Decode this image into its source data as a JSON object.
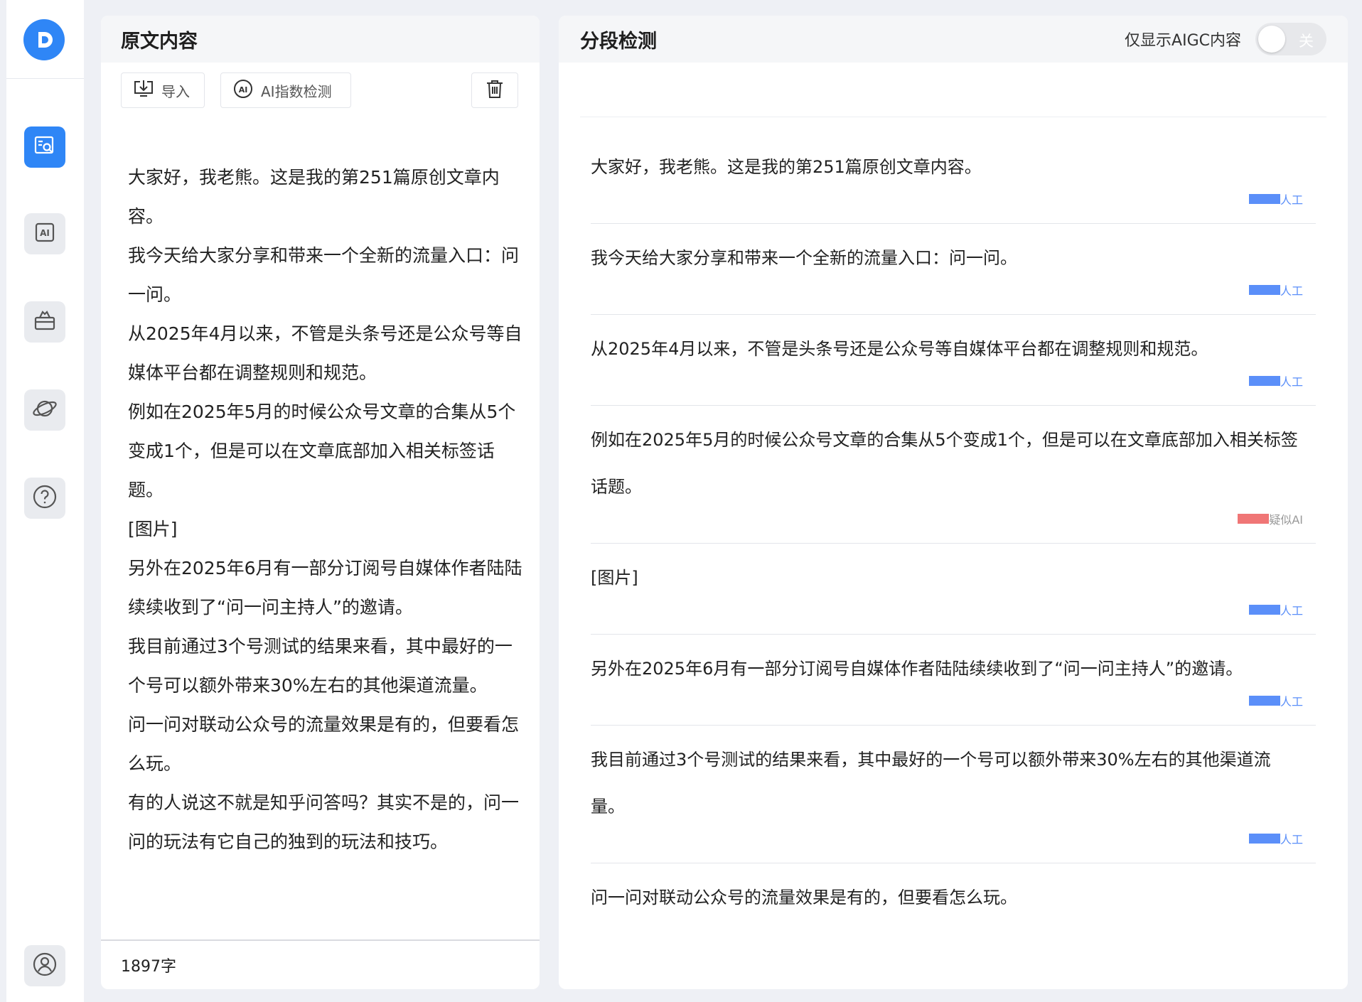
{
  "sidebar": {
    "logo": "logo-icon",
    "items": [
      {
        "icon": "document-search-icon",
        "active": true
      },
      {
        "icon": "ai-icon",
        "active": false
      },
      {
        "icon": "toolbox-icon",
        "active": false
      },
      {
        "icon": "planet-icon",
        "active": false
      },
      {
        "icon": "help-icon",
        "active": false
      }
    ],
    "bottom": {
      "icon": "user-icon"
    }
  },
  "left": {
    "title": "原文内容",
    "import_label": "导入",
    "ai_detect_label": "AI指数检测",
    "paragraphs": [
      "大家好，我老熊。这是我的第251篇原创文章内容。",
      "我今天给大家分享和带来一个全新的流量入口：问一问。",
      "从2025年4月以来，不管是头条号还是公众号等自媒体平台都在调整规则和规范。",
      "例如在2025年5月的时候公众号文章的合集从5个变成1个，但是可以在文章底部加入相关标签话题。",
      "[图片]",
      "另外在2025年6月有一部分订阅号自媒体作者陆陆续续收到了“问一问主持人”的邀请。",
      "我目前通过3个号测试的结果来看，其中最好的一个号可以额外带来30%左右的其他渠道流量。",
      "问一问对联动公众号的流量效果是有的，但要看怎么玩。",
      "有的人说这不就是知乎问答吗？其实不是的，问一问的玩法有它自己的独到的玩法和技巧。"
    ],
    "word_count": "1897字"
  },
  "right": {
    "title": "分段检测",
    "toggle_label": "仅显示AIGC内容",
    "toggle_state": "关",
    "segments": [
      {
        "text": "大家好，我老熊。这是我的第251篇原创文章内容。",
        "tag": "人工",
        "type": "human"
      },
      {
        "text": "我今天给大家分享和带来一个全新的流量入口：问一问。",
        "tag": "人工",
        "type": "human"
      },
      {
        "text": "从2025年4月以来，不管是头条号还是公众号等自媒体平台都在调整规则和规范。",
        "tag": "人工",
        "type": "human"
      },
      {
        "text": "例如在2025年5月的时候公众号文章的合集从5个变成1个，但是可以在文章底部加入相关标签话题。",
        "tag": "疑似AI",
        "type": "ai"
      },
      {
        "text": "[图片]",
        "tag": "人工",
        "type": "human"
      },
      {
        "text": "另外在2025年6月有一部分订阅号自媒体作者陆陆续续收到了“问一问主持人”的邀请。",
        "tag": "人工",
        "type": "human"
      },
      {
        "text": "我目前通过3个号测试的结果来看，其中最好的一个号可以额外带来30%左右的其他渠道流量。",
        "tag": "人工",
        "type": "human"
      },
      {
        "text": "问一问对联动公众号的流量效果是有的，但要看怎么玩。",
        "tag": "",
        "type": "human"
      }
    ]
  },
  "colors": {
    "accent": "#2f86f6",
    "human_tag": "#5b8ff9",
    "ai_tag": "#f07676"
  }
}
